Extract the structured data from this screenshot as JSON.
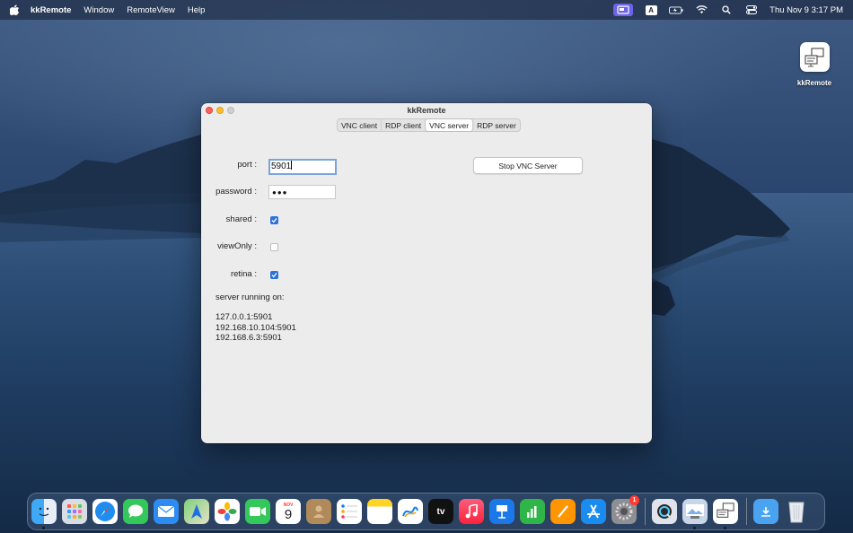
{
  "menubar": {
    "app_name": "kkRemote",
    "items": [
      "Window",
      "RemoteView",
      "Help"
    ],
    "input_source": "A",
    "clock": "Thu Nov 9  3:17 PM"
  },
  "desktop_icon": {
    "label": "kkRemote"
  },
  "window": {
    "title": "kkRemote",
    "tabs": [
      "VNC client",
      "RDP client",
      "VNC server",
      "RDP server"
    ],
    "selected_tab": "VNC server",
    "form": {
      "port_label": "port :",
      "port_value": "5901",
      "password_label": "password :",
      "password_value": "●●●",
      "shared_label": "shared :",
      "shared_checked": true,
      "viewonly_label": "viewOnly :",
      "viewonly_checked": false,
      "retina_label": "retina :",
      "retina_checked": true
    },
    "stop_button": "Stop VNC Server",
    "server_running_label": "server running on:",
    "addresses": [
      "127.0.0.1:5901",
      "192.168.10.104:5901",
      "192.168.6.3:5901"
    ]
  },
  "dock": {
    "calendar_month": "NOV",
    "calendar_day": "9",
    "tv_label": "tv",
    "settings_badge": "1"
  },
  "colors": {
    "accent": "#2a72dc",
    "focus_ring": "#7aa4dc",
    "active_status": "#6b63e8"
  }
}
